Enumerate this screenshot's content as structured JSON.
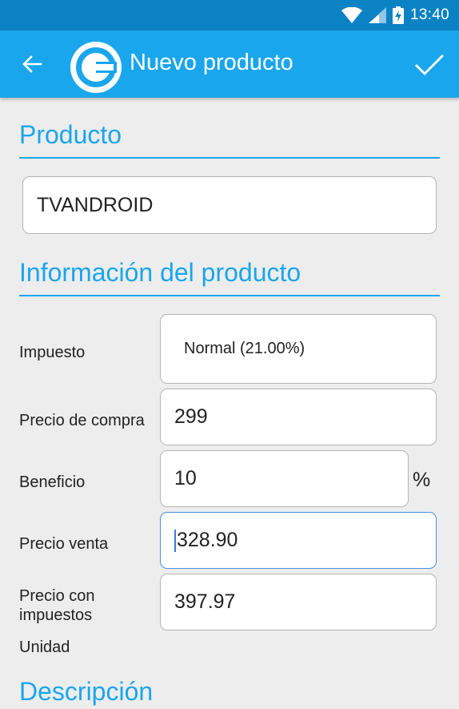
{
  "status_bar": {
    "time": "13:40"
  },
  "app_bar": {
    "title": "Nuevo producto",
    "back_icon": "arrow-back-icon",
    "confirm_icon": "check-icon",
    "logo_icon": "brand-logo"
  },
  "colors": {
    "accent": "#1aa6ec",
    "status_bar": "#0b82c4",
    "background": "#ededed"
  },
  "sections": {
    "producto": "Producto",
    "informacion": "Información del producto",
    "descripcion": "Descripción"
  },
  "producto": {
    "name": "TVANDROID"
  },
  "informacion": {
    "impuesto_label": "Impuesto",
    "impuesto_value": "Normal (21.00%)",
    "precio_compra_label": "Precio de compra",
    "precio_compra_value": "299",
    "beneficio_label": "Beneficio",
    "beneficio_value": "10",
    "beneficio_unit": "%",
    "precio_venta_label": "Precio venta",
    "precio_venta_value": "328.90",
    "precio_impuestos_label_1": "Precio con",
    "precio_impuestos_label_2": "impuestos",
    "precio_impuestos_value": "397.97",
    "unidad_label": "Unidad"
  }
}
